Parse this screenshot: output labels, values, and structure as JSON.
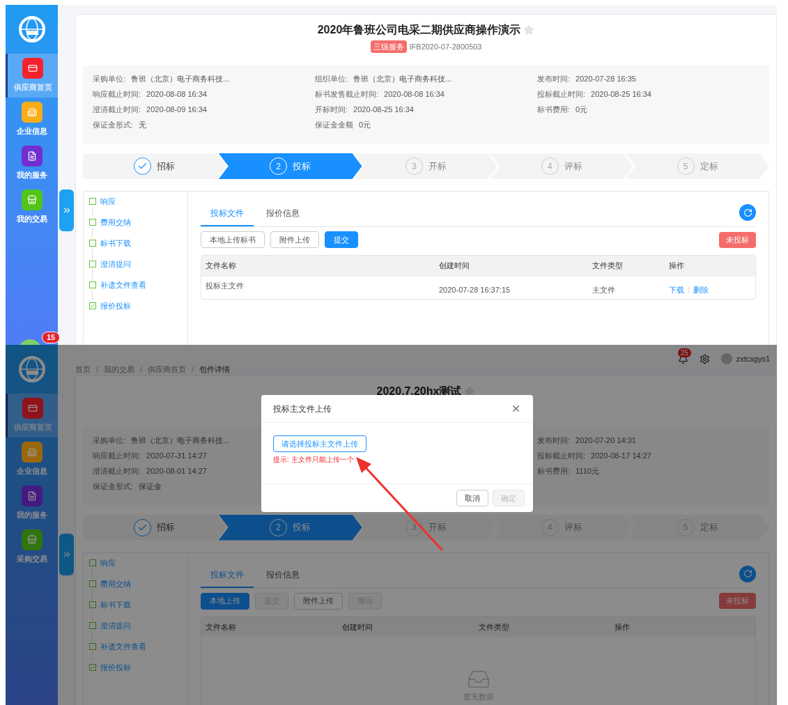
{
  "panels": [
    {
      "sidebar": {
        "items": [
          {
            "label": "供应商首页",
            "color": "#f5222d",
            "selected": true
          },
          {
            "label": "企业信息",
            "color": "#faad14",
            "selected": false
          },
          {
            "label": "我的服务",
            "color": "#722ed1",
            "selected": false
          },
          {
            "label": "我的交易",
            "color": "#52c41a",
            "selected": false
          }
        ],
        "badge": "15"
      },
      "card": {
        "title": "2020年鲁班公司电采二期供应商操作演示",
        "tag": "三级服务",
        "code": "IFB2020-07-2800503",
        "info": {
          "left": [
            {
              "label": "采购单位:",
              "value": "鲁班（北京）电子商务科技..."
            },
            {
              "label": "响应截止时间:",
              "value": "2020-08-08 16:34"
            },
            {
              "label": "澄清截止时间:",
              "value": "2020-08-09 16:34"
            },
            {
              "label": "保证金形式:",
              "value": "无"
            }
          ],
          "middle": [
            {
              "label": "组织单位:",
              "value": "鲁班（北京）电子商务科技..."
            },
            {
              "label": "标书发售截止时间:",
              "value": "2020-08-08 16:34"
            },
            {
              "label": "开标时间:",
              "value": "2020-08-25 16:34"
            },
            {
              "label": "保证金金额",
              "value": "0元"
            }
          ],
          "right": [
            {
              "label": "发布时间:",
              "value": "2020-07-28 16:35"
            },
            {
              "label": "投标截止时间:",
              "value": "2020-08-25 16:34"
            },
            {
              "label": "标书费用:",
              "value": "0元"
            }
          ]
        },
        "steps": [
          {
            "label": "招标",
            "done": true,
            "selected": false
          },
          {
            "number": "2",
            "label": "投标",
            "done": false,
            "selected": true
          },
          {
            "number": "3",
            "label": "开标",
            "done": false,
            "selected": false
          },
          {
            "number": "4",
            "label": "评标",
            "done": false,
            "selected": false
          },
          {
            "number": "5",
            "label": "定标",
            "done": false,
            "selected": false
          }
        ],
        "progress": [
          {
            "label": "响应",
            "checked": false
          },
          {
            "label": "费用交纳",
            "checked": false
          },
          {
            "label": "标书下载",
            "checked": false
          },
          {
            "label": "澄清提问",
            "checked": false
          },
          {
            "label": "补遗文件查看",
            "checked": false
          },
          {
            "label": "报价投标",
            "checked": true
          }
        ],
        "tabs": [
          {
            "label": "投标文件",
            "selected": true
          },
          {
            "label": "报价信息",
            "selected": false
          }
        ],
        "buttons": [
          {
            "label": "本地上传标书",
            "kind": "default",
            "disabled": false
          },
          {
            "label": "附件上传",
            "kind": "default",
            "disabled": false
          },
          {
            "label": "提交",
            "kind": "primary",
            "disabled": false
          }
        ],
        "status": "未投标",
        "table": {
          "columns": [
            "文件名称",
            "创建时间",
            "文件类型",
            "操作"
          ],
          "rows": [
            {
              "name": "投标主文件",
              "created": "2020-07-28 16:37:15",
              "type": "主文件",
              "actions": [
                "下载",
                "删除"
              ]
            }
          ]
        }
      }
    },
    {
      "header": {
        "breadcrumb": [
          "首页",
          "我的交易",
          "供应商首页",
          "包件详情"
        ],
        "separator": "/",
        "notifications": "25",
        "username": "zxtcsgys1"
      },
      "sidebar": {
        "items": [
          {
            "label": "供应商首页",
            "color": "#8f1319",
            "selected": true
          },
          {
            "label": "企业信息",
            "color": "#9a680c",
            "selected": false
          },
          {
            "label": "我的服务",
            "color": "#441a80",
            "selected": false
          },
          {
            "label": "采购交易",
            "color": "#2f7410",
            "selected": false
          }
        ]
      },
      "card": {
        "title": "2020.7.20hx测试",
        "info": {
          "left": [
            {
              "label": "采购单位:",
              "value": "鲁班（北京）电子商务科技..."
            },
            {
              "label": "响应截止时间:",
              "value": "2020-07-31 14:27"
            },
            {
              "label": "澄清截止时间:",
              "value": "2020-08-01 14:27"
            },
            {
              "label": "保证金形式:",
              "value": "保证金"
            }
          ],
          "right": [
            {
              "label": "发布时间:",
              "value": "2020-07-20 14:31"
            },
            {
              "label": "投标截止时间:",
              "value": "2020-08-17 14:27"
            },
            {
              "label": "标书费用:",
              "value": "1110元"
            }
          ]
        },
        "steps": [
          {
            "label": "招标",
            "done": true,
            "selected": false
          },
          {
            "number": "2",
            "label": "投标",
            "done": false,
            "selected": true
          },
          {
            "number": "3",
            "label": "开标",
            "done": false,
            "selected": false
          },
          {
            "number": "4",
            "label": "评标",
            "done": false,
            "selected": false
          },
          {
            "number": "5",
            "label": "定标",
            "done": false,
            "selected": false
          }
        ],
        "progress": [
          {
            "label": "响应",
            "checked": false
          },
          {
            "label": "费用交纳",
            "checked": false
          },
          {
            "label": "标书下载",
            "checked": false
          },
          {
            "label": "澄清提问",
            "checked": false
          },
          {
            "label": "补遗文件查看",
            "checked": false
          },
          {
            "label": "报价投标",
            "checked": true
          }
        ],
        "tabs": [
          {
            "label": "投标文件",
            "selected": true
          },
          {
            "label": "报价信息",
            "selected": false
          }
        ],
        "buttons": [
          {
            "label": "本地上传",
            "kind": "primary",
            "disabled": false
          },
          {
            "label": "提交",
            "kind": "default",
            "disabled": true
          },
          {
            "label": "附件上传",
            "kind": "default",
            "disabled": false
          },
          {
            "label": "撤回",
            "kind": "default",
            "disabled": true
          }
        ],
        "status": "未投标",
        "table": {
          "columns": [
            "文件名称",
            "创建时间",
            "文件类型",
            "操作"
          ],
          "empty": "暂无数据"
        }
      },
      "dialog": {
        "title": "投标主文件上传",
        "upload": "请选择投标主文件上传",
        "hint": "提示: 主文件只能上传一个",
        "buttons": [
          {
            "label": "取消",
            "disabled": false
          },
          {
            "label": "确定",
            "disabled": true
          }
        ]
      }
    }
  ]
}
